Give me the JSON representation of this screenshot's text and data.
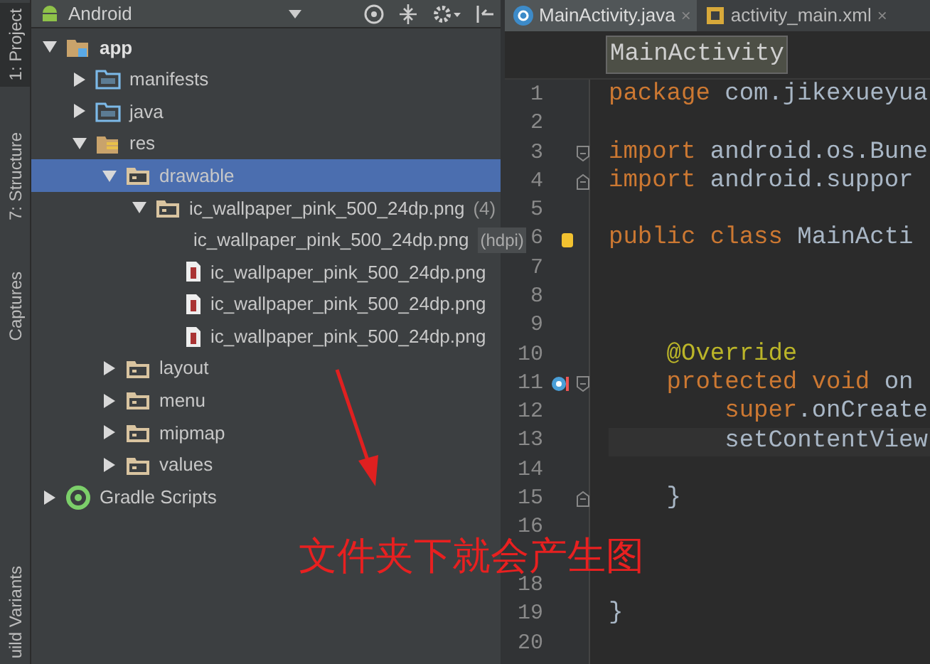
{
  "tool_strip": [
    {
      "label": "1: Project",
      "selected": true
    },
    {
      "label": "7: Structure",
      "selected": false
    },
    {
      "label": "Captures",
      "selected": false
    },
    {
      "label": "uild Variants",
      "selected": false
    }
  ],
  "project_panel": {
    "view": "Android",
    "tree": [
      {
        "label": "app",
        "kind": "module",
        "expanded": true,
        "selected": false,
        "children": [
          {
            "label": "manifests",
            "kind": "folder",
            "expanded": false,
            "selected": false
          },
          {
            "label": "java",
            "kind": "folder",
            "expanded": false,
            "selected": false
          },
          {
            "label": "res",
            "kind": "res",
            "expanded": true,
            "selected": false,
            "children": [
              {
                "label": "drawable",
                "kind": "resfolder",
                "expanded": true,
                "selected": true,
                "children": [
                  {
                    "label": "ic_wallpaper_pink_500_24dp.png",
                    "count": "(4)",
                    "kind": "group",
                    "expanded": true,
                    "selected": false,
                    "children": [
                      {
                        "label": "ic_wallpaper_pink_500_24dp.png",
                        "tooltip": "(hdpi)",
                        "kind": "file",
                        "selected": false
                      },
                      {
                        "label": "ic_wallpaper_pink_500_24dp.png",
                        "kind": "file",
                        "selected": false
                      },
                      {
                        "label": "ic_wallpaper_pink_500_24dp.png",
                        "kind": "file",
                        "selected": false
                      },
                      {
                        "label": "ic_wallpaper_pink_500_24dp.png",
                        "kind": "file",
                        "selected": false
                      }
                    ]
                  }
                ]
              },
              {
                "label": "layout",
                "kind": "resfolder",
                "expanded": false,
                "selected": false
              },
              {
                "label": "menu",
                "kind": "resfolder",
                "expanded": false,
                "selected": false
              },
              {
                "label": "mipmap",
                "kind": "resfolder",
                "expanded": false,
                "selected": false
              },
              {
                "label": "values",
                "kind": "resfolder",
                "expanded": false,
                "selected": false
              }
            ]
          }
        ]
      },
      {
        "label": "Gradle Scripts",
        "kind": "gradle",
        "expanded": false,
        "selected": false
      }
    ]
  },
  "editor": {
    "tabs": [
      {
        "label": "MainActivity.java",
        "kind": "java",
        "close": "×",
        "selected": true
      },
      {
        "label": "activity_main.xml",
        "kind": "xml",
        "close": "×",
        "selected": false
      }
    ],
    "breadcrumb": "MainActivity",
    "lines": [
      {
        "number": "1",
        "tokens": [
          {
            "text": "package",
            "kind": "keyword"
          },
          {
            "text": " com.jikexueyua",
            "kind": "plain"
          }
        ]
      },
      {
        "number": "2"
      },
      {
        "number": "3",
        "fold_open": true,
        "tokens": [
          {
            "text": "import",
            "kind": "keyword"
          },
          {
            "text": " android.os.Bune",
            "kind": "plain"
          }
        ]
      },
      {
        "number": "4",
        "fold_close": true,
        "tokens": [
          {
            "text": "import",
            "kind": "keyword"
          },
          {
            "text": " android.suppor",
            "kind": "plain"
          }
        ]
      },
      {
        "number": "5"
      },
      {
        "number": "6",
        "lightbulb": true,
        "tokens": [
          {
            "text": "public class ",
            "kind": "keyword"
          },
          {
            "text": "MainActi",
            "kind": "plain"
          }
        ]
      },
      {
        "number": "7"
      },
      {
        "number": "8"
      },
      {
        "number": "9"
      },
      {
        "number": "10",
        "tokens": [
          {
            "text": "    @Override",
            "kind": "annotation"
          }
        ]
      },
      {
        "number": "11",
        "override_marker": true,
        "fold_open": true,
        "tokens": [
          {
            "text": "    protected void ",
            "kind": "keyword"
          },
          {
            "text": "on",
            "kind": "plain"
          }
        ]
      },
      {
        "number": "12",
        "tokens": [
          {
            "text": "        super",
            "kind": "keyword"
          },
          {
            "text": ".onCreate",
            "kind": "plain"
          }
        ]
      },
      {
        "number": "13",
        "current": true,
        "tokens": [
          {
            "text": "        setContentView",
            "kind": "plain"
          }
        ]
      },
      {
        "number": "14"
      },
      {
        "number": "15",
        "fold_close": true,
        "tokens": [
          {
            "text": "    }",
            "kind": "plain"
          }
        ]
      },
      {
        "number": "16"
      },
      {
        "covered": true
      },
      {
        "number": "18"
      },
      {
        "number": "19",
        "tokens": [
          {
            "text": "}",
            "kind": "plain"
          }
        ]
      },
      {
        "number": "20"
      }
    ]
  },
  "annotation": {
    "text": "文件夹下就会产生图"
  }
}
